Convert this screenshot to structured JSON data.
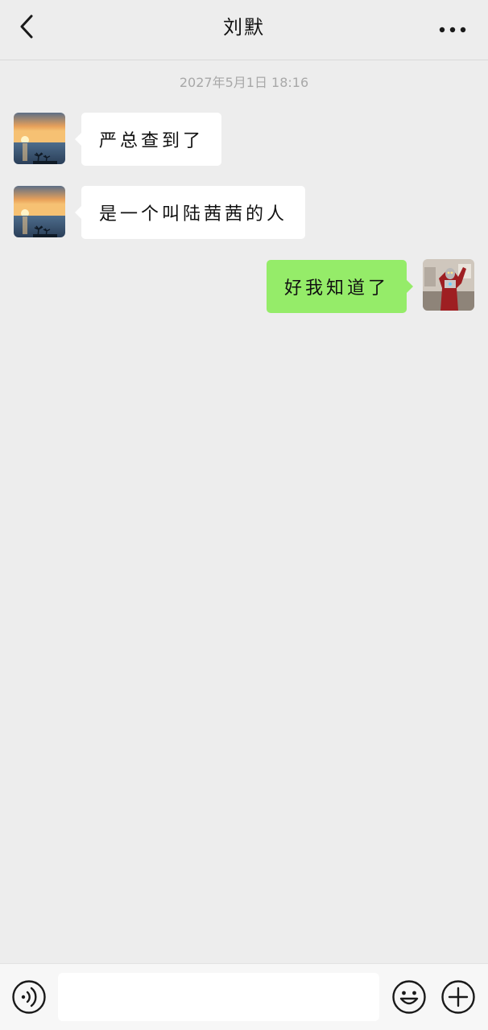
{
  "header": {
    "title": "刘默",
    "back_icon": "chevron-left-icon",
    "more_icon": "more-horizontal-icon"
  },
  "chat": {
    "timestamp": "2027年5月1日 18:16",
    "messages": [
      {
        "direction": "incoming",
        "text": "严总查到了",
        "avatar": "sunset-avatar"
      },
      {
        "direction": "incoming",
        "text": "是一个叫陆茜茜的人",
        "avatar": "sunset-avatar"
      },
      {
        "direction": "outgoing",
        "text": "好我知道了",
        "avatar": "hero-figure-avatar"
      }
    ]
  },
  "input_bar": {
    "voice_icon": "voice-icon",
    "message_value": "",
    "emoji_icon": "emoji-icon",
    "plus_icon": "plus-icon"
  },
  "colors": {
    "background": "#ededed",
    "incoming_bubble": "#ffffff",
    "outgoing_bubble": "#95ec69",
    "timestamp_text": "#a8a8a8"
  }
}
